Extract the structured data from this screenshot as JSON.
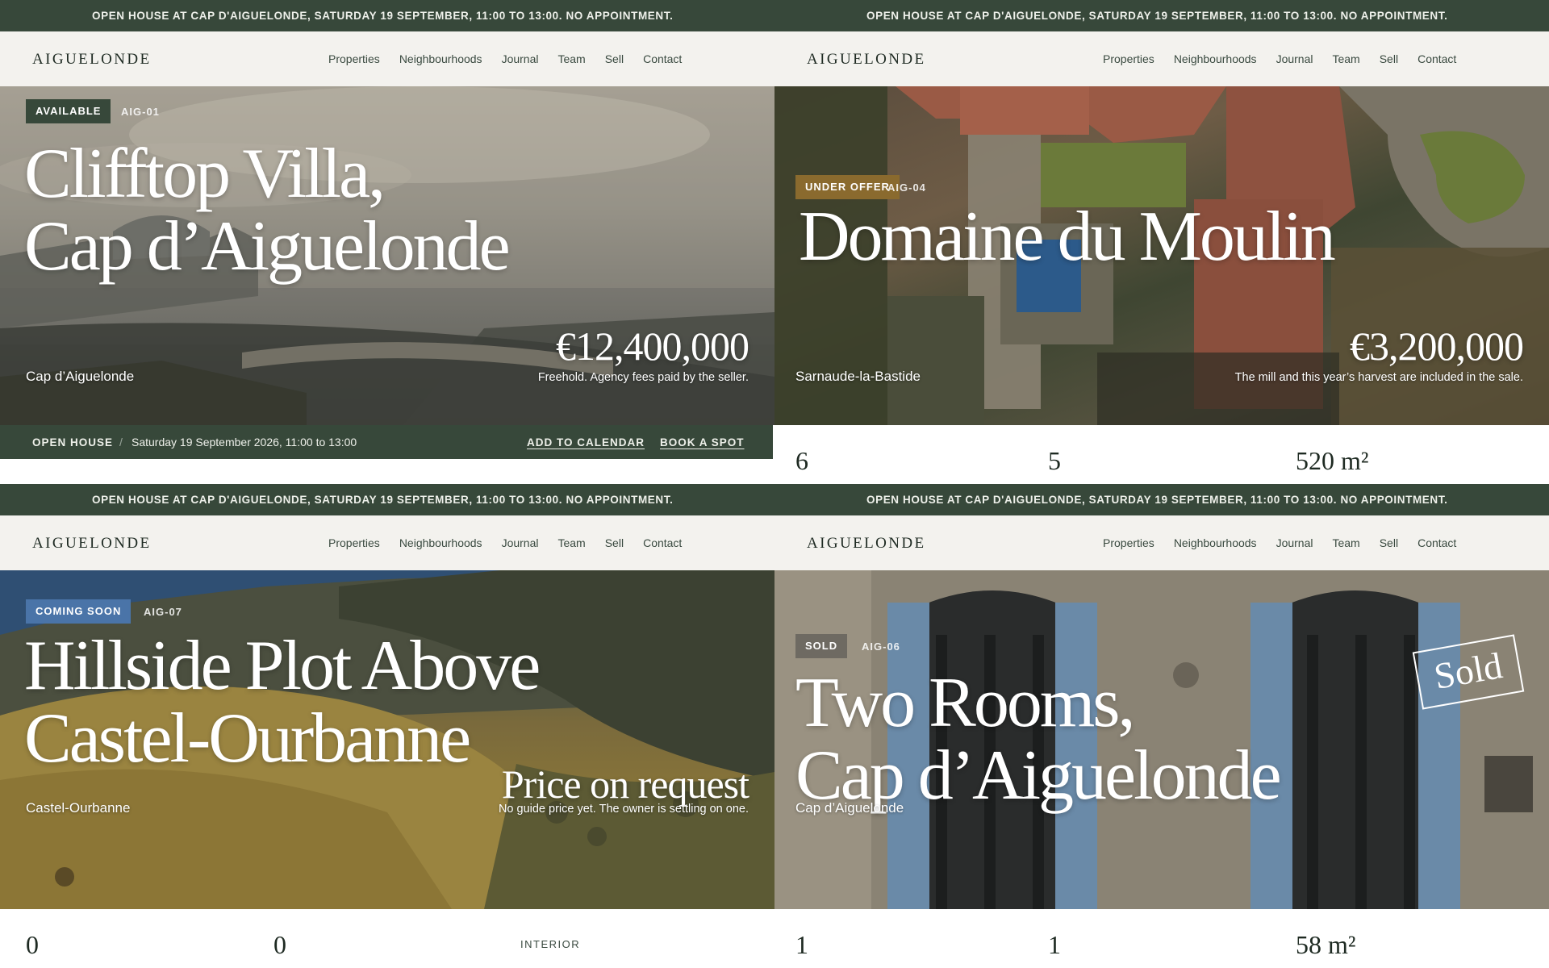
{
  "panels": [
    {
      "announcement": "OPEN HOUSE AT CAP D'AIGUELONDE, SATURDAY 19 SEPTEMBER, 11:00 TO 13:00. NO APPOINTMENT.",
      "logo": "AIGUELONDE",
      "nav": [
        "Properties",
        "Neighbourhoods",
        "Journal",
        "Team",
        "Sell",
        "Contact"
      ],
      "status": "AVAILABLE",
      "status_color": "#37483a",
      "ref": "AIG-01",
      "title_line1": "Clifftop Villa,",
      "title_line2": "Cap d’Aiguelonde",
      "locality": "Cap d’Aiguelonde",
      "price": "€12,400,000",
      "price_note": "Freehold. Agency fees paid by the seller.",
      "open_house": {
        "label": "OPEN HOUSE",
        "separator": "/",
        "date": "Saturday 19 September 2026, 11:00 to 13:00",
        "add_to_calendar": "ADD TO CALENDAR",
        "book_a_spot": "BOOK A SPOT"
      }
    },
    {
      "announcement": "OPEN HOUSE AT CAP D'AIGUELONDE, SATURDAY 19 SEPTEMBER, 11:00 TO 13:00. NO APPOINTMENT.",
      "logo": "AIGUELONDE",
      "nav": [
        "Properties",
        "Neighbourhoods",
        "Journal",
        "Team",
        "Sell",
        "Contact"
      ],
      "status": "UNDER OFFER",
      "status_color": "#8a6a2e",
      "ref": "AIG-04",
      "title_line1": "Domaine du Moulin",
      "locality": "Sarnaude-la-Bastide",
      "price": "€3,200,000",
      "price_note": "The mill and this year’s harvest are included in the sale.",
      "stats": [
        "6",
        "5",
        "520 m²"
      ]
    },
    {
      "announcement": "OPEN HOUSE AT CAP D'AIGUELONDE, SATURDAY 19 SEPTEMBER, 11:00 TO 13:00. NO APPOINTMENT.",
      "logo": "AIGUELONDE",
      "nav": [
        "Properties",
        "Neighbourhoods",
        "Journal",
        "Team",
        "Sell",
        "Contact"
      ],
      "status": "COMING SOON",
      "status_color": "#4a74a8",
      "ref": "AIG-07",
      "title_line1": "Hillside Plot Above",
      "title_line2": "Castel-Ourbanne",
      "locality": "Castel-Ourbanne",
      "price": "Price on request",
      "price_note": "No guide price yet. The owner is settling on one.",
      "stats": [
        "0",
        "0"
      ],
      "interior_label": "INTERIOR"
    },
    {
      "announcement": "OPEN HOUSE AT CAP D'AIGUELONDE, SATURDAY 19 SEPTEMBER, 11:00 TO 13:00. NO APPOINTMENT.",
      "logo": "AIGUELONDE",
      "nav": [
        "Properties",
        "Neighbourhoods",
        "Journal",
        "Team",
        "Sell",
        "Contact"
      ],
      "status": "SOLD",
      "status_color": "#6e6a62",
      "ref": "AIG-06",
      "title_line1": "Two Rooms,",
      "title_line2": "Cap d’Aiguelonde",
      "locality": "Cap d’Aiguelonde",
      "sold_stamp": "Sold",
      "stats": [
        "1",
        "1",
        "58 m²"
      ]
    }
  ]
}
